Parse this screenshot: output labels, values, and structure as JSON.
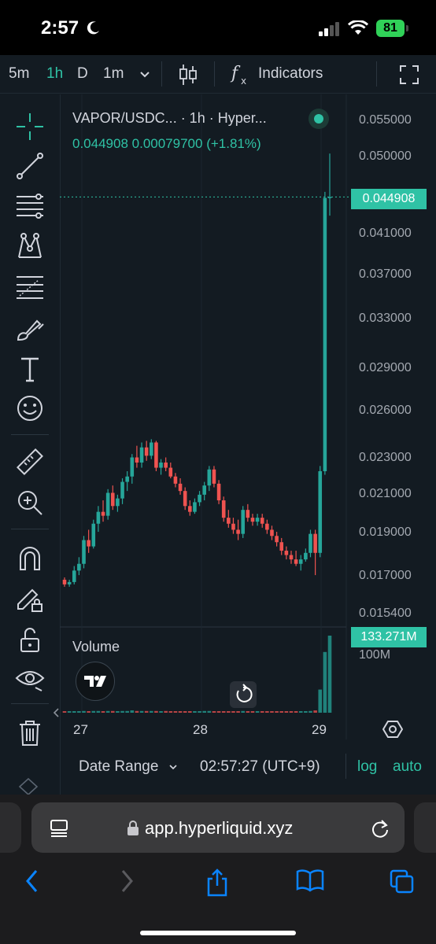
{
  "status_bar": {
    "time": "2:57",
    "battery": "81"
  },
  "toolbar": {
    "timeframes": [
      "5m",
      "1h",
      "D",
      "1m"
    ],
    "active_timeframe": "1h",
    "indicators_label": "Indicators"
  },
  "legend": {
    "title": "VAPOR/USDC... · 1h · Hyper...",
    "last": "0.044908",
    "change": "0.00079700",
    "change_pct": "(+1.81%)"
  },
  "price_axis": {
    "labels": [
      "0.055000",
      "0.050000",
      "0.044908",
      "0.041000",
      "0.037000",
      "0.033000",
      "0.029000",
      "0.026000",
      "0.023000",
      "0.021000",
      "0.019000",
      "0.017000",
      "0.015400"
    ],
    "current_price": "0.044908"
  },
  "volume": {
    "label": "Volume",
    "current": "133.271M",
    "scale_label": "100M"
  },
  "time_axis": {
    "labels": [
      "27",
      "28",
      "29"
    ]
  },
  "bottom_bar": {
    "date_range": "Date Range",
    "time": "02:57:27 (UTC+9)",
    "log": "log",
    "auto": "auto"
  },
  "browser": {
    "url": "app.hyperliquid.xyz"
  },
  "colors": {
    "up": "#26a69a",
    "down": "#ef5350",
    "accent": "#2fc2a5",
    "background": "#131b22"
  },
  "chart_data": {
    "type": "candlestick",
    "interval": "1h",
    "y_scale": "log",
    "x_labels": [
      "27",
      "28",
      "29"
    ],
    "ylim": [
      0.0154,
      0.055
    ],
    "ohlc": [
      [
        0.0168,
        0.0169,
        0.0165,
        0.0166
      ],
      [
        0.0166,
        0.0168,
        0.0165,
        0.0167
      ],
      [
        0.0167,
        0.0174,
        0.0166,
        0.0172
      ],
      [
        0.0172,
        0.0178,
        0.017,
        0.0175
      ],
      [
        0.0175,
        0.0188,
        0.0173,
        0.0186
      ],
      [
        0.0186,
        0.0191,
        0.018,
        0.0183
      ],
      [
        0.0183,
        0.0196,
        0.0182,
        0.0194
      ],
      [
        0.0194,
        0.0203,
        0.019,
        0.02
      ],
      [
        0.02,
        0.0206,
        0.0195,
        0.0198
      ],
      [
        0.0198,
        0.0212,
        0.0196,
        0.021
      ],
      [
        0.021,
        0.0214,
        0.0201,
        0.0203
      ],
      [
        0.0203,
        0.0209,
        0.02,
        0.0207
      ],
      [
        0.0207,
        0.0218,
        0.0204,
        0.0216
      ],
      [
        0.0216,
        0.0222,
        0.0211,
        0.0219
      ],
      [
        0.0219,
        0.0232,
        0.0215,
        0.023
      ],
      [
        0.023,
        0.0237,
        0.0224,
        0.0227
      ],
      [
        0.0227,
        0.0239,
        0.0224,
        0.0236
      ],
      [
        0.0236,
        0.024,
        0.0228,
        0.0231
      ],
      [
        0.0231,
        0.0241,
        0.0229,
        0.0239
      ],
      [
        0.0239,
        0.024,
        0.0222,
        0.0224
      ],
      [
        0.0224,
        0.0229,
        0.022,
        0.0227
      ],
      [
        0.0227,
        0.023,
        0.0222,
        0.0224
      ],
      [
        0.0224,
        0.0227,
        0.0218,
        0.0219
      ],
      [
        0.0219,
        0.0221,
        0.0213,
        0.0215
      ],
      [
        0.0215,
        0.0218,
        0.0209,
        0.0211
      ],
      [
        0.0211,
        0.0213,
        0.0201,
        0.0203
      ],
      [
        0.0203,
        0.0206,
        0.0198,
        0.02
      ],
      [
        0.02,
        0.0207,
        0.0199,
        0.0205
      ],
      [
        0.0205,
        0.0211,
        0.0203,
        0.0209
      ],
      [
        0.0209,
        0.0216,
        0.0206,
        0.0214
      ],
      [
        0.0214,
        0.0225,
        0.0211,
        0.0223
      ],
      [
        0.0223,
        0.0225,
        0.0213,
        0.0215
      ],
      [
        0.0215,
        0.0217,
        0.0204,
        0.0206
      ],
      [
        0.0206,
        0.0208,
        0.0195,
        0.0197
      ],
      [
        0.0197,
        0.0201,
        0.0192,
        0.0194
      ],
      [
        0.0194,
        0.0197,
        0.0189,
        0.0191
      ],
      [
        0.0191,
        0.0196,
        0.0186,
        0.0189
      ],
      [
        0.0189,
        0.0203,
        0.0187,
        0.0201
      ],
      [
        0.0201,
        0.0204,
        0.0195,
        0.0197
      ],
      [
        0.0197,
        0.0199,
        0.0193,
        0.0195
      ],
      [
        0.0195,
        0.0199,
        0.0193,
        0.0197
      ],
      [
        0.0197,
        0.0199,
        0.0192,
        0.0194
      ],
      [
        0.0194,
        0.0196,
        0.0189,
        0.0191
      ],
      [
        0.0191,
        0.0193,
        0.0186,
        0.0188
      ],
      [
        0.0188,
        0.019,
        0.0183,
        0.0185
      ],
      [
        0.0185,
        0.0187,
        0.0179,
        0.0181
      ],
      [
        0.0181,
        0.0183,
        0.0177,
        0.0179
      ],
      [
        0.0179,
        0.0181,
        0.0175,
        0.0177
      ],
      [
        0.0177,
        0.0181,
        0.0174,
        0.0175
      ],
      [
        0.0175,
        0.0179,
        0.0172,
        0.0177
      ],
      [
        0.0177,
        0.0182,
        0.0176,
        0.018
      ],
      [
        0.018,
        0.0191,
        0.0178,
        0.0189
      ],
      [
        0.0189,
        0.0191,
        0.017,
        0.018
      ],
      [
        0.018,
        0.0225,
        0.0178,
        0.0222
      ],
      [
        0.0222,
        0.0455,
        0.022,
        0.0448
      ],
      [
        0.0448,
        0.0502,
        0.0428,
        0.0449
      ]
    ],
    "volume": [
      2,
      2,
      2,
      2,
      3,
      2,
      3,
      3,
      2,
      3,
      3,
      2,
      3,
      3,
      4,
      3,
      3,
      3,
      3,
      3,
      2,
      3,
      2,
      2,
      2,
      2,
      2,
      2,
      2,
      3,
      3,
      2,
      2,
      2,
      2,
      2,
      2,
      3,
      2,
      2,
      2,
      2,
      2,
      2,
      2,
      2,
      2,
      2,
      2,
      2,
      2,
      3,
      4,
      40,
      105,
      133.271
    ]
  }
}
